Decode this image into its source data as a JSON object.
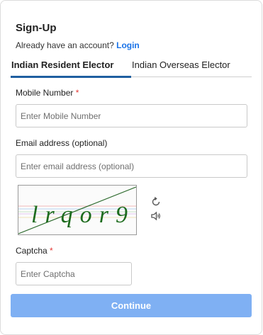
{
  "form": {
    "title": "Sign-Up",
    "account_prompt": "Already have an account?",
    "login_label": "Login"
  },
  "tabs": [
    {
      "label": "Indian Resident Elector",
      "active": true
    },
    {
      "label": "Indian Overseas Elector",
      "active": false
    }
  ],
  "mobile": {
    "label": "Mobile Number",
    "required_mark": "*",
    "placeholder": "Enter Mobile Number",
    "value": ""
  },
  "email": {
    "label": "Email address (optional)",
    "placeholder": "Enter email address (optional)",
    "value": ""
  },
  "captcha": {
    "image_text": "lrqor9",
    "refresh_icon": "refresh-icon",
    "audio_icon": "speaker-icon",
    "label": "Captcha",
    "required_mark": "*",
    "placeholder": "Enter Captcha",
    "value": ""
  },
  "actions": {
    "continue_label": "Continue"
  },
  "colors": {
    "accent_link": "#1a73e8",
    "tab_underline": "#1f5fa0",
    "required": "#e53935",
    "button_bg": "#7fb0f3"
  }
}
